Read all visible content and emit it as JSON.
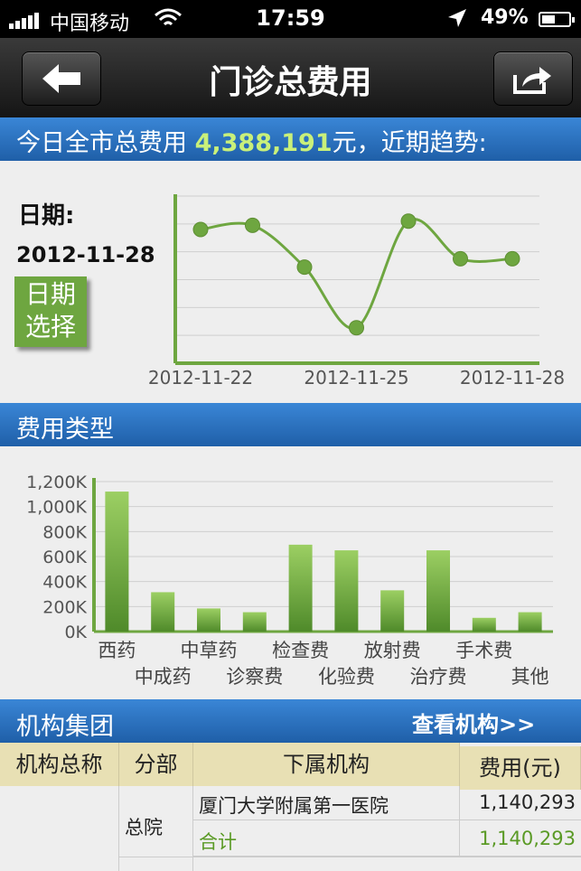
{
  "status": {
    "carrier": "中国移动",
    "time": "17:59",
    "battery": "49%"
  },
  "nav": {
    "title": "门诊总费用",
    "back_icon": "back-arrow-icon",
    "share_icon": "share-icon"
  },
  "summary": {
    "prefix": "今日全市总费用",
    "amount": "4,388,191",
    "suffix": "元，近期趋势:"
  },
  "date": {
    "label": "日期:",
    "value": "2012-11-28",
    "button": "日期选择",
    "button_line1": "日期",
    "button_line2": "选择"
  },
  "section2": {
    "title": "费用类型"
  },
  "section3": {
    "title": "机构集团",
    "link": "查看机构>>"
  },
  "table": {
    "headers": [
      "机构总称",
      "分部",
      "下属机构",
      "费用(元)"
    ],
    "rows": [
      {
        "branch": "总院",
        "org": "厦门大学附属第一医院",
        "fee": "1,140,293"
      },
      {
        "org": "合计",
        "fee": "1,140,293"
      }
    ]
  },
  "chart_data": [
    {
      "type": "line",
      "x": [
        "2012-11-22",
        "2012-11-23",
        "2012-11-24",
        "2012-11-25",
        "2012-11-26",
        "2012-11-27",
        "2012-11-28"
      ],
      "x_tick_labels": [
        "2012-11-22",
        "2012-11-25",
        "2012-11-28"
      ],
      "values": [
        6.4,
        6.6,
        4.6,
        1.7,
        6.8,
        5.0,
        5.0
      ],
      "ylim": [
        0,
        8
      ],
      "grid": true,
      "color": "#6ea640"
    },
    {
      "type": "bar",
      "categories": [
        "西药",
        "中成药",
        "中草药",
        "诊察费",
        "检查费",
        "化验费",
        "放射费",
        "治疗费",
        "手术费",
        "其他"
      ],
      "values": [
        1120000,
        315000,
        185000,
        155000,
        695000,
        650000,
        330000,
        650000,
        110000,
        155000
      ],
      "ylim": [
        0,
        1200000
      ],
      "y_tick_labels": [
        "0K",
        "200K",
        "400K",
        "600K",
        "800K",
        "1,000K",
        "1,200K"
      ],
      "grid": true,
      "color": "#6ea640"
    }
  ]
}
